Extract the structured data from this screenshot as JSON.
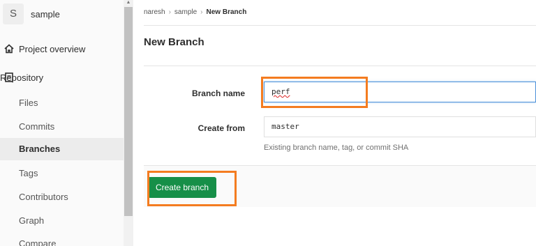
{
  "project": {
    "avatar_letter": "S",
    "name": "sample"
  },
  "sidebar": {
    "items": [
      {
        "label": "Project overview",
        "icon": "home-icon",
        "kind": "top"
      },
      {
        "label": "Repository",
        "icon": "book-icon",
        "kind": "section"
      },
      {
        "label": "Files",
        "kind": "sub"
      },
      {
        "label": "Commits",
        "kind": "sub"
      },
      {
        "label": "Branches",
        "kind": "sub",
        "active": true
      },
      {
        "label": "Tags",
        "kind": "sub"
      },
      {
        "label": "Contributors",
        "kind": "sub"
      },
      {
        "label": "Graph",
        "kind": "sub"
      },
      {
        "label": "Compare",
        "kind": "sub"
      }
    ]
  },
  "breadcrumb": {
    "items": [
      "naresh",
      "sample"
    ],
    "current": "New Branch"
  },
  "page": {
    "title": "New Branch"
  },
  "form": {
    "branch_name": {
      "label": "Branch name",
      "value": "perf"
    },
    "create_from": {
      "label": "Create from",
      "value": "master",
      "help": "Existing branch name, tag, or commit SHA"
    }
  },
  "actions": {
    "create_label": "Create branch"
  },
  "colors": {
    "accent_green": "#168f48",
    "highlight_orange": "#f47c20",
    "focus_blue": "#4a90d9"
  }
}
